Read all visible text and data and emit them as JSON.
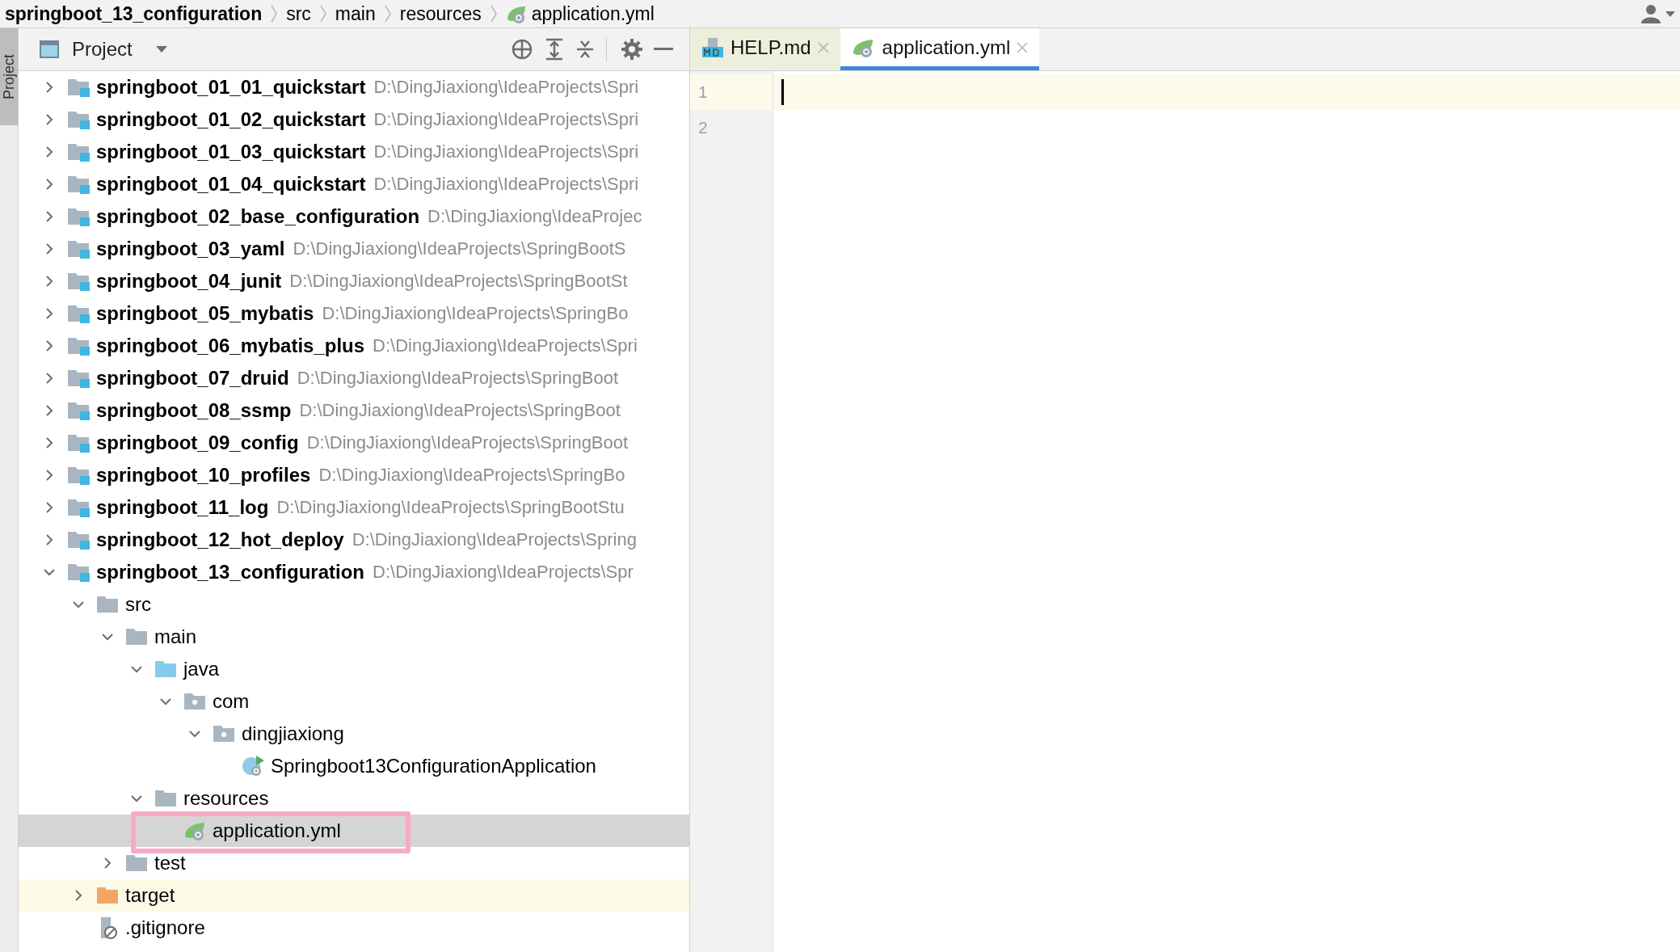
{
  "breadcrumb": [
    {
      "label": "springboot_13_configuration",
      "kind": "module"
    },
    {
      "label": "src",
      "kind": "plain"
    },
    {
      "label": "main",
      "kind": "plain"
    },
    {
      "label": "resources",
      "kind": "plain"
    },
    {
      "label": "application.yml",
      "kind": "spring-yml"
    }
  ],
  "stripe": {
    "label": "Project"
  },
  "panel": {
    "title": "Project"
  },
  "tree": [
    {
      "name": "springboot_01_01_quickstart",
      "path": "D:\\DingJiaxiong\\IdeaProjects\\Spri",
      "kind": "module",
      "expanded": false,
      "selected": false
    },
    {
      "name": "springboot_01_02_quickstart",
      "path": "D:\\DingJiaxiong\\IdeaProjects\\Spri",
      "kind": "module",
      "expanded": false,
      "selected": false
    },
    {
      "name": "springboot_01_03_quickstart",
      "path": "D:\\DingJiaxiong\\IdeaProjects\\Spri",
      "kind": "module",
      "expanded": false,
      "selected": false
    },
    {
      "name": "springboot_01_04_quickstart",
      "path": "D:\\DingJiaxiong\\IdeaProjects\\Spri",
      "kind": "module",
      "expanded": false,
      "selected": false
    },
    {
      "name": "springboot_02_base_configuration",
      "path": "D:\\DingJiaxiong\\IdeaProjec",
      "kind": "module",
      "expanded": false,
      "selected": false
    },
    {
      "name": "springboot_03_yaml",
      "path": "D:\\DingJiaxiong\\IdeaProjects\\SpringBootS",
      "kind": "module",
      "expanded": false,
      "selected": false
    },
    {
      "name": "springboot_04_junit",
      "path": "D:\\DingJiaxiong\\IdeaProjects\\SpringBootSt",
      "kind": "module",
      "expanded": false,
      "selected": false
    },
    {
      "name": "springboot_05_mybatis",
      "path": "D:\\DingJiaxiong\\IdeaProjects\\SpringBo",
      "kind": "module",
      "expanded": false,
      "selected": false
    },
    {
      "name": "springboot_06_mybatis_plus",
      "path": "D:\\DingJiaxiong\\IdeaProjects\\Spri",
      "kind": "module",
      "expanded": false,
      "selected": false
    },
    {
      "name": "springboot_07_druid",
      "path": "D:\\DingJiaxiong\\IdeaProjects\\SpringBoot",
      "kind": "module",
      "expanded": false,
      "selected": false
    },
    {
      "name": "springboot_08_ssmp",
      "path": "D:\\DingJiaxiong\\IdeaProjects\\SpringBoot",
      "kind": "module",
      "expanded": false,
      "selected": false
    },
    {
      "name": "springboot_09_config",
      "path": "D:\\DingJiaxiong\\IdeaProjects\\SpringBoot",
      "kind": "module",
      "expanded": false,
      "selected": false
    },
    {
      "name": "springboot_10_profiles",
      "path": "D:\\DingJiaxiong\\IdeaProjects\\SpringBo",
      "kind": "module",
      "expanded": false,
      "selected": false
    },
    {
      "name": "springboot_11_log",
      "path": "D:\\DingJiaxiong\\IdeaProjects\\SpringBootStu",
      "kind": "module",
      "expanded": false,
      "selected": false
    },
    {
      "name": "springboot_12_hot_deploy",
      "path": "D:\\DingJiaxiong\\IdeaProjects\\Spring",
      "kind": "module",
      "expanded": false,
      "selected": false
    },
    {
      "name": "springboot_13_configuration",
      "path": "D:\\DingJiaxiong\\IdeaProjects\\Spr",
      "kind": "module",
      "expanded": true,
      "selected": false,
      "children": [
        {
          "name": "src",
          "kind": "folder",
          "expanded": true,
          "selected": false,
          "children": [
            {
              "name": "main",
              "kind": "folder",
              "expanded": true,
              "selected": false,
              "children": [
                {
                  "name": "java",
                  "kind": "source-folder",
                  "expanded": true,
                  "selected": false,
                  "children": [
                    {
                      "name": "com",
                      "kind": "package",
                      "expanded": true,
                      "selected": false,
                      "children": [
                        {
                          "name": "dingjiaxiong",
                          "kind": "package",
                          "expanded": true,
                          "selected": false,
                          "children": [
                            {
                              "name": "Springboot13ConfigurationApplication",
                              "kind": "spring-class",
                              "selected": false
                            }
                          ]
                        }
                      ]
                    }
                  ]
                },
                {
                  "name": "resources",
                  "kind": "resource-folder",
                  "expanded": true,
                  "selected": false,
                  "children": [
                    {
                      "name": "application.yml",
                      "kind": "spring-yml",
                      "selected": true,
                      "marked": true
                    }
                  ]
                }
              ]
            },
            {
              "name": "test",
              "kind": "folder",
              "expanded": false,
              "selected": false
            }
          ]
        },
        {
          "name": "target",
          "kind": "excluded-folder",
          "expanded": false,
          "selected": false
        },
        {
          "name": ".gitignore",
          "kind": "ignored-file",
          "selected": false
        }
      ]
    }
  ],
  "tabs": [
    {
      "label": "HELP.md",
      "kind": "markdown",
      "selected": false
    },
    {
      "label": "application.yml",
      "kind": "spring-yml",
      "selected": true
    }
  ],
  "editor": {
    "lines": [
      "1",
      "2"
    ]
  }
}
